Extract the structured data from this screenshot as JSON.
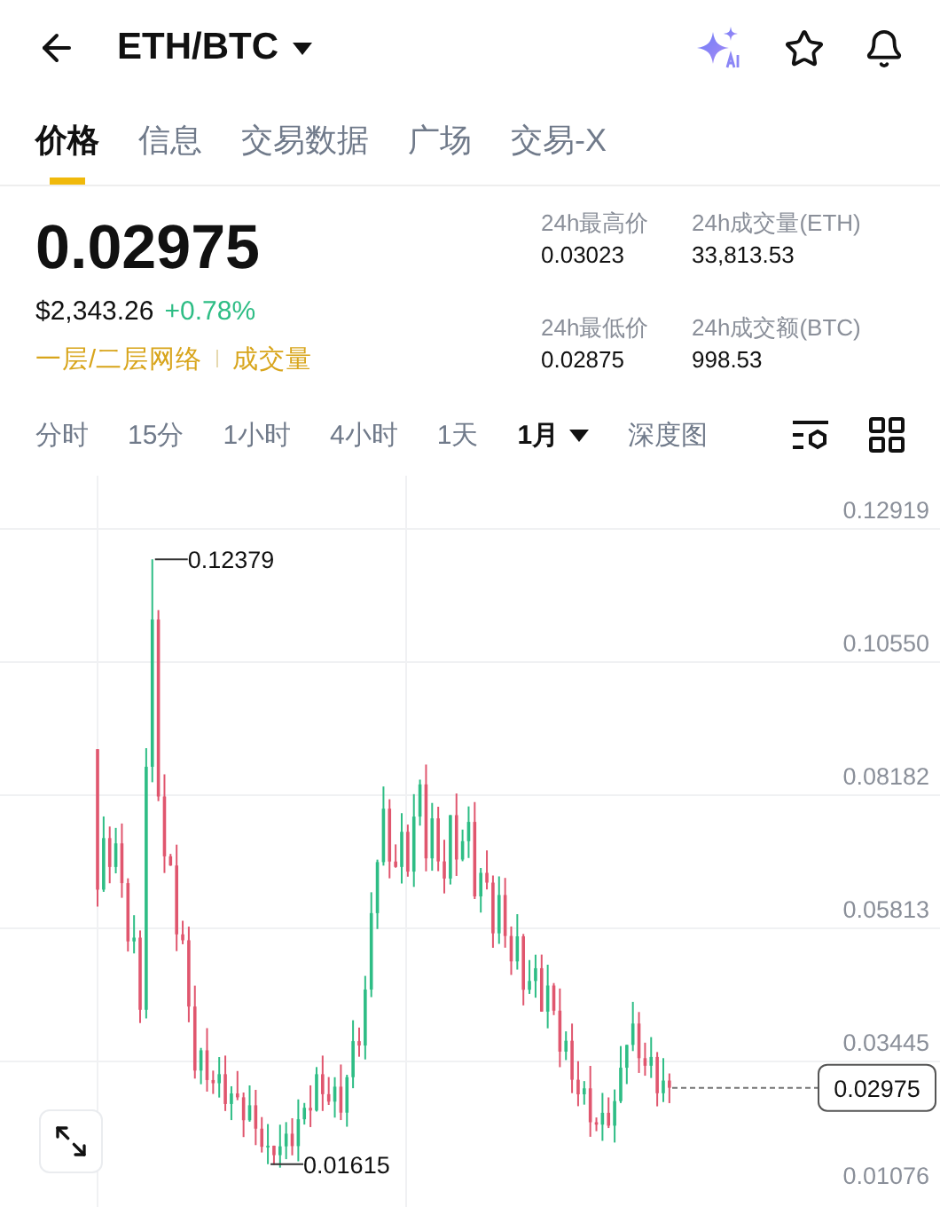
{
  "header": {
    "pair": "ETH/BTC"
  },
  "tabs": [
    {
      "label": "价格",
      "selected": true
    },
    {
      "label": "信息",
      "selected": false
    },
    {
      "label": "交易数据",
      "selected": false
    },
    {
      "label": "广场",
      "selected": false
    },
    {
      "label": "交易-X",
      "selected": false
    }
  ],
  "price": {
    "last": "0.02975",
    "usd": "$2,343.26",
    "change": "+0.78%",
    "tags": [
      "一层/二层网络",
      "成交量"
    ]
  },
  "stats": [
    {
      "label": "24h最高价",
      "value": "0.03023"
    },
    {
      "label": "24h成交量(ETH)",
      "value": "33,813.53"
    },
    {
      "label": "24h最低价",
      "value": "0.02875"
    },
    {
      "label": "24h成交额(BTC)",
      "value": "998.53"
    }
  ],
  "intervals": [
    {
      "label": "分时",
      "selected": false,
      "kind": "plain"
    },
    {
      "label": "15分",
      "selected": false,
      "kind": "plain"
    },
    {
      "label": "1小时",
      "selected": false,
      "kind": "plain"
    },
    {
      "label": "4小时",
      "selected": false,
      "kind": "plain"
    },
    {
      "label": "1天",
      "selected": false,
      "kind": "plain"
    },
    {
      "label": "1月",
      "selected": true,
      "kind": "dropdown"
    },
    {
      "label": "深度图",
      "selected": false,
      "kind": "plain"
    }
  ],
  "chart": {
    "y_labels": [
      "0.12919",
      "0.10550",
      "0.08182",
      "0.05813",
      "0.03445",
      "0.01076"
    ],
    "high_marker": "0.12379",
    "low_marker": "0.01615",
    "current_price": "0.02975"
  }
}
